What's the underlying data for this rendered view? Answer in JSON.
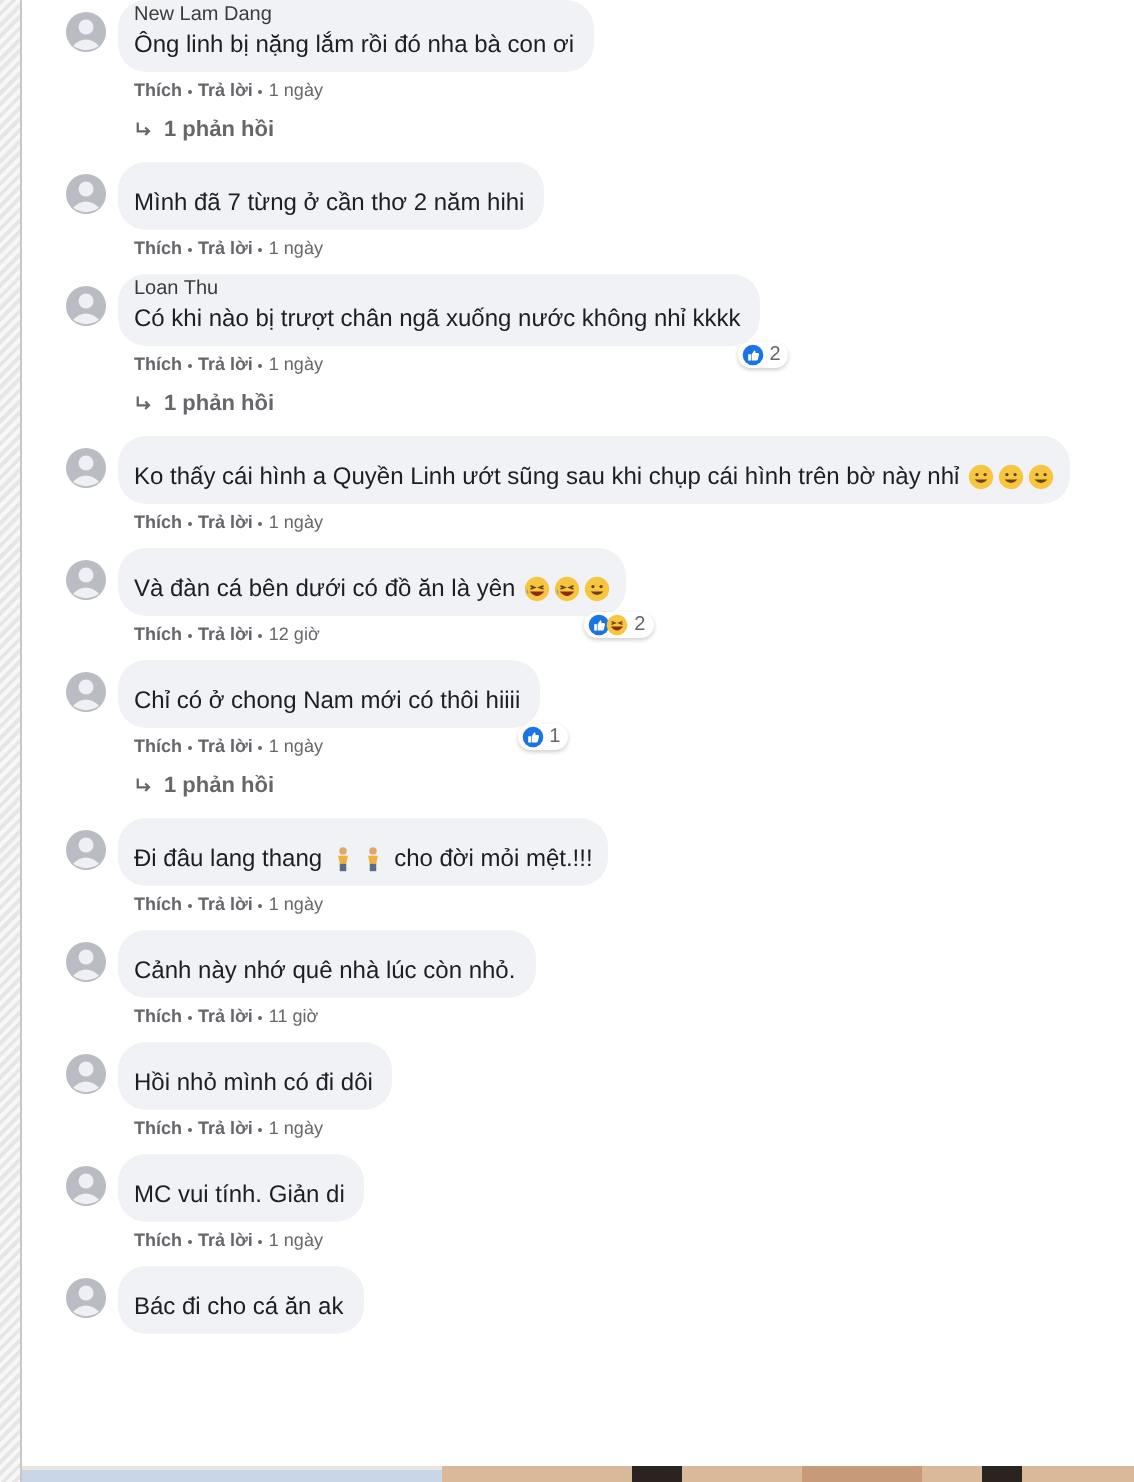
{
  "comments": [
    {
      "name": "New Lam Dang",
      "parts": [
        {
          "kind": "text",
          "text": "Ông linh bị nặng lắm rồi đó nha bà con ơi"
        }
      ],
      "actions": [
        "Thích",
        "Trả lời"
      ],
      "time": "1 ngày",
      "replies": "1 phản hồi"
    },
    {
      "parts": [
        {
          "kind": "text",
          "text": "Mình đã 7 từng ở cần thơ 2 năm hihi"
        }
      ],
      "actions": [
        "Thích",
        "Trả lời"
      ],
      "time": "1 ngày"
    },
    {
      "name": "Loan Thu",
      "parts": [
        {
          "kind": "text",
          "text": "Có khi nào bị trượt chân ngã xuống nước không nhỉ kkkk"
        }
      ],
      "reactions": {
        "icons": [
          {
            "kind": "like"
          }
        ],
        "count": "2"
      },
      "actions": [
        "Thích",
        "Trả lời"
      ],
      "time": "1 ngày",
      "replies": "1 phản hồi"
    },
    {
      "parts": [
        {
          "kind": "text",
          "text": "Ko thấy cái hình a Quyền Linh ướt sũng sau khi chụp cái hình trên bờ này nhỉ"
        },
        {
          "kind": "smile"
        },
        {
          "kind": "smile"
        },
        {
          "kind": "smile"
        }
      ],
      "actions": [
        "Thích",
        "Trả lời"
      ],
      "time": "1 ngày"
    },
    {
      "parts": [
        {
          "kind": "text",
          "text": "Và đàn cá bên dưới có đồ ăn là yên"
        },
        {
          "kind": "laugh"
        },
        {
          "kind": "laugh"
        },
        {
          "kind": "smile"
        }
      ],
      "reactions": {
        "icons": [
          {
            "kind": "like"
          },
          {
            "kind": "haha"
          }
        ],
        "count": "2"
      },
      "actions": [
        "Thích",
        "Trả lời"
      ],
      "time": "12 giờ"
    },
    {
      "parts": [
        {
          "kind": "text",
          "text": "Chỉ có ở chong Nam mới có thôi hiiii"
        }
      ],
      "reactions": {
        "icons": [
          {
            "kind": "like"
          }
        ],
        "count": "1"
      },
      "actions": [
        "Thích",
        "Trả lời"
      ],
      "time": "1 ngày",
      "replies": "1 phản hồi"
    },
    {
      "parts": [
        {
          "kind": "text",
          "text": "Đi đâu lang thang"
        },
        {
          "kind": "figure"
        },
        {
          "kind": "figure"
        },
        {
          "kind": "text",
          "text": "cho đời mỏi mệt.!!!"
        }
      ],
      "actions": [
        "Thích",
        "Trả lời"
      ],
      "time": "1 ngày"
    },
    {
      "parts": [
        {
          "kind": "text",
          "text": "Cảnh này nhớ quê nhà lúc còn nhỏ."
        }
      ],
      "actions": [
        "Thích",
        "Trả lời"
      ],
      "time": "11 giờ"
    },
    {
      "parts": [
        {
          "kind": "text",
          "text": "Hồi nhỏ mình có đi dôi"
        }
      ],
      "actions": [
        "Thích",
        "Trả lời"
      ],
      "time": "1 ngày"
    },
    {
      "parts": [
        {
          "kind": "text",
          "text": "MC vui tính. Giản di"
        }
      ],
      "actions": [
        "Thích",
        "Trả lời"
      ],
      "time": "1 ngày"
    },
    {
      "parts": [
        {
          "kind": "text",
          "text": "Bác đi cho cá ăn ak"
        }
      ]
    }
  ]
}
